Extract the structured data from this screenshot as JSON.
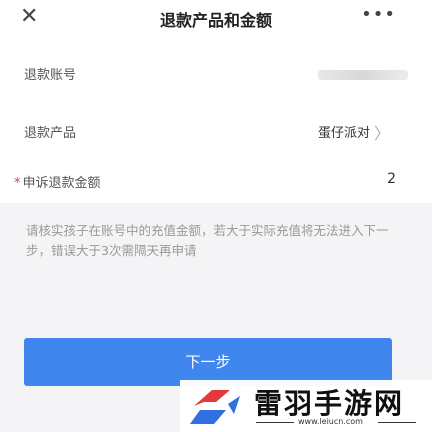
{
  "header": {
    "close_icon": "✕",
    "title": "退款产品和金额",
    "more_icon": "•••"
  },
  "form": {
    "account": {
      "label": "退款账号",
      "value": ""
    },
    "product": {
      "label": "退款产品",
      "value": "蛋仔派对"
    },
    "amount": {
      "required_mark": "*",
      "label": "申诉退款金额",
      "value": "2"
    }
  },
  "hint": "请核实孩子在账号中的充值金额，若大于实际充值将无法进入下一步，错误大于3次需隔天再申请",
  "next_button": "下一步",
  "watermark": {
    "name": "雷羽手游网",
    "url": "www.leiucn.com"
  },
  "colors": {
    "primary": "#3f86ee",
    "required": "#e04040",
    "hint_text": "#999999",
    "logo_red": "#e23a3a",
    "logo_blue": "#2f6fe0"
  }
}
